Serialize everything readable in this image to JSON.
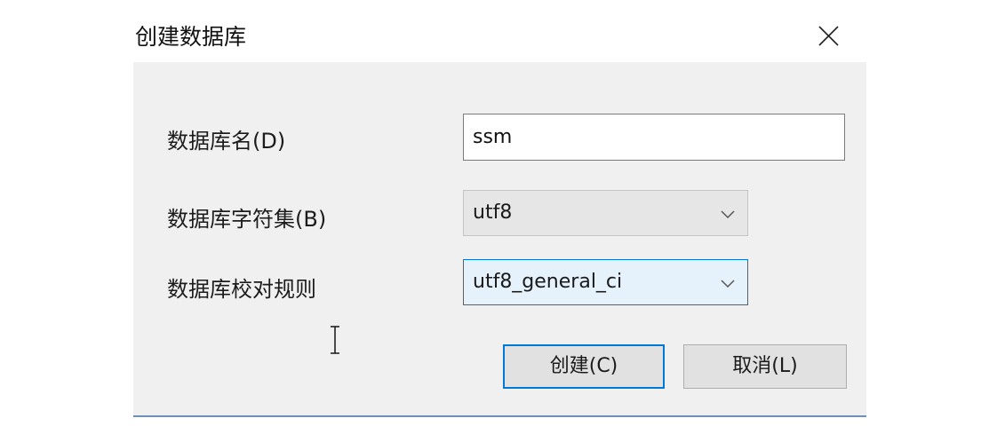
{
  "dialog": {
    "title": "创建数据库",
    "close_icon": "close-icon"
  },
  "form": {
    "name_label": "数据库名(D)",
    "name_value": "ssm",
    "charset_label": "数据库字符集(B)",
    "charset_value": "utf8",
    "collation_label": "数据库校对规则",
    "collation_value": "utf8_general_ci"
  },
  "buttons": {
    "create_label": "创建(C)",
    "cancel_label": "取消(L)"
  },
  "colors": {
    "dialog_bg": "#f0f0f0",
    "accent": "#0078d7",
    "focused_select_bg": "#e5f1fb"
  }
}
